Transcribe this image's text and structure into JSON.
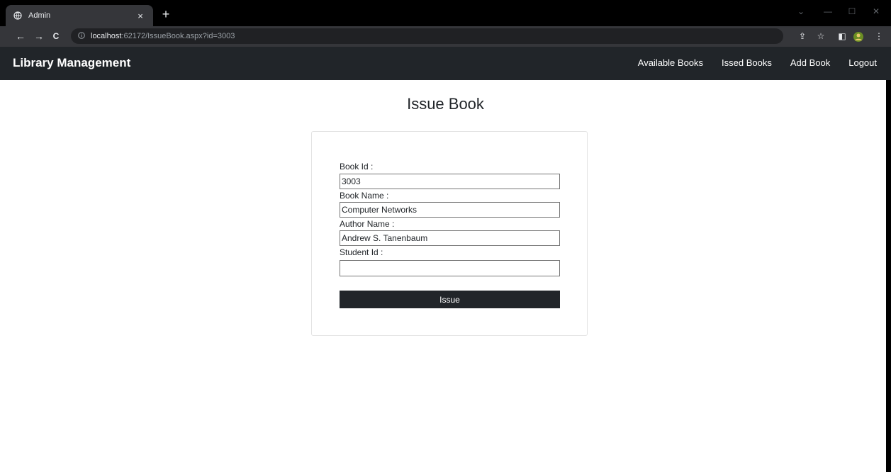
{
  "browser": {
    "tab_title": "Admin",
    "tab_close": "×",
    "new_tab": "+",
    "url_host": "localhost",
    "url_rest": ":62172/IssueBook.aspx?id=3003",
    "icons": [
      "globe-icon",
      "close-icon",
      "plus-icon",
      "back-icon",
      "forward-icon",
      "reload-icon",
      "info-icon",
      "share-icon",
      "star-icon",
      "sidepanel-icon",
      "profile-icon",
      "menu-icon",
      "minimize-icon",
      "maximize-icon",
      "window-close-icon"
    ],
    "back": "←",
    "forward": "→",
    "reload": "C",
    "share": "⇪",
    "star": "☆",
    "side": "◧",
    "menu": "⋮",
    "minimize": "—",
    "maximize": "☐",
    "win_close": "✕",
    "chevron": "⌄"
  },
  "nav": {
    "brand": "Library Management",
    "links": [
      "Available Books",
      "Issed Books",
      "Add Book",
      "Logout"
    ]
  },
  "page": {
    "title": "Issue Book"
  },
  "form": {
    "book_id_label": "Book Id :",
    "book_id_value": "3003",
    "book_name_label": "Book Name :",
    "book_name_value": "Computer Networks",
    "author_label": "Author Name :",
    "author_value": "Andrew S. Tanenbaum",
    "student_label": "Student Id :",
    "student_value": "",
    "submit_label": "Issue"
  },
  "colors": {
    "navbar": "#212529",
    "button": "#212529",
    "browser_frame": "#35363a"
  }
}
